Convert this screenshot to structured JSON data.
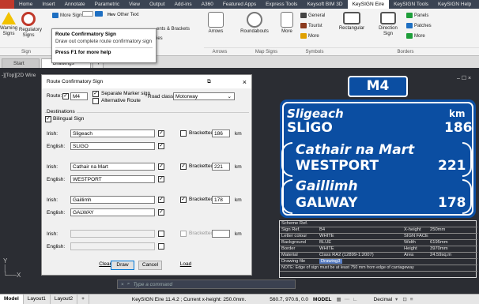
{
  "menu": [
    "Home",
    "Insert",
    "Annotate",
    "Parametric",
    "View",
    "Output",
    "Add-ins",
    "A360",
    "Featured Apps",
    "Express Tools",
    "Keysoft BIM 3D",
    "KeySIGN Eire",
    "KeySIGN Tools",
    "KeySIGN Help"
  ],
  "menu_active": "KeySIGN Eire",
  "ribbon": {
    "warning_signs": "Warning Signs",
    "regulatory_signs": "Regulatory Signs",
    "more_signs": "More Signs",
    "other_text": "Other Text",
    "elements_brackets": "ents & Brackets",
    "lines": "ies",
    "arrows1": "Arrows",
    "arrows2": "Arrows",
    "roundabouts": "Roundabouts",
    "more": "More",
    "general": "General",
    "tourist": "Tourist",
    "more2": "More",
    "rectangular": "Rectangular",
    "direction_sign": "Direction Sign",
    "panels": "Panels",
    "patches": "Patches",
    "more3": "More",
    "group_signs": "Sign",
    "group_arrows": "Arrows",
    "group_map_signs": "Map Signs",
    "group_symbols": "Symbols",
    "group_borders": "Borders"
  },
  "tooltip": {
    "title": "Route Confirmatory Sign",
    "desc": "Draw out complete route confirmatory sign",
    "help": "Press F1 for more help"
  },
  "doc_tabs": [
    "Start",
    "Drawings*"
  ],
  "viewport_label": "-][Top][2D Wire",
  "window_controls": "– ☐ ×",
  "dialog": {
    "title": "Route Confirmatory Sign",
    "route_label": "Route:",
    "route_value": "M4",
    "separate_marker": "Separate Marker sign",
    "alternative_route": "Alternative Route",
    "road_class_label": "Road class",
    "road_class_value": "Motorway",
    "destinations_label": "Destinations",
    "bilingual": "Bilingual Sign",
    "irish_label": "Irish:",
    "english_label": "English:",
    "bracketed_label": "Bracketted",
    "km_label": "km",
    "destinations": [
      {
        "irish": "Sligeach",
        "english": "SLIGO",
        "bracketed": false,
        "km": "186"
      },
      {
        "irish": "Cathair na Mart",
        "english": "WESTPORT",
        "bracketed": true,
        "km": "221"
      },
      {
        "irish": "Gaillimh",
        "english": "GALWAY",
        "bracketed": true,
        "km": "178"
      },
      {
        "irish": "",
        "english": "",
        "bracketed": false,
        "km": ""
      }
    ],
    "clear_btn": "Clear",
    "save_btn": "Save",
    "load_btn": "Load",
    "draw_btn": "Draw",
    "cancel_btn": "Cancel"
  },
  "sign": {
    "route": "M4",
    "km_unit": "km",
    "lines": [
      {
        "irish": "Sligeach",
        "english": "SLIGO",
        "km": "186"
      },
      {
        "irish": "Cathair na Mart",
        "english": "WESTPORT",
        "km": "221"
      },
      {
        "irish": "Gaillimh",
        "english": "GALWAY",
        "km": "178"
      }
    ]
  },
  "schedule": {
    "title": "Scheme Ref.",
    "sign_ref_label": "Sign Ref.",
    "sign_ref": "B4",
    "xheight_label": "X-height",
    "xheight": "250mm",
    "letter_colour_label": "Letter colour",
    "letter_colour": "WHITE",
    "sign_face_label": "SIGN FACE",
    "background_label": "Background",
    "background": "BLUE",
    "width_label": "Width",
    "width": "6195mm",
    "border_label": "Border",
    "border": "WHITE",
    "height_label": "Height",
    "height": "3970mm",
    "material_label": "Material",
    "material": "Class RA2 (12899-1:2007)",
    "area_label": "Area",
    "area": "24.59sq.m",
    "drawing_file_label": "Drawing file",
    "drawing_file": "Drawing3",
    "note": "NOTE: Edge of sign must be at least   750   mm from edge of carriageway"
  },
  "command": {
    "placeholder": "Type a command"
  },
  "status": {
    "layouts": [
      "Model",
      "Layout1",
      "Layout2"
    ],
    "info": "KeySIGN Eire 11.4.2 ;  Current x-height: 250.0mm.",
    "coords": "560.7, 970.6, 0.0",
    "model": "MODEL",
    "decimal": "Decimal"
  }
}
